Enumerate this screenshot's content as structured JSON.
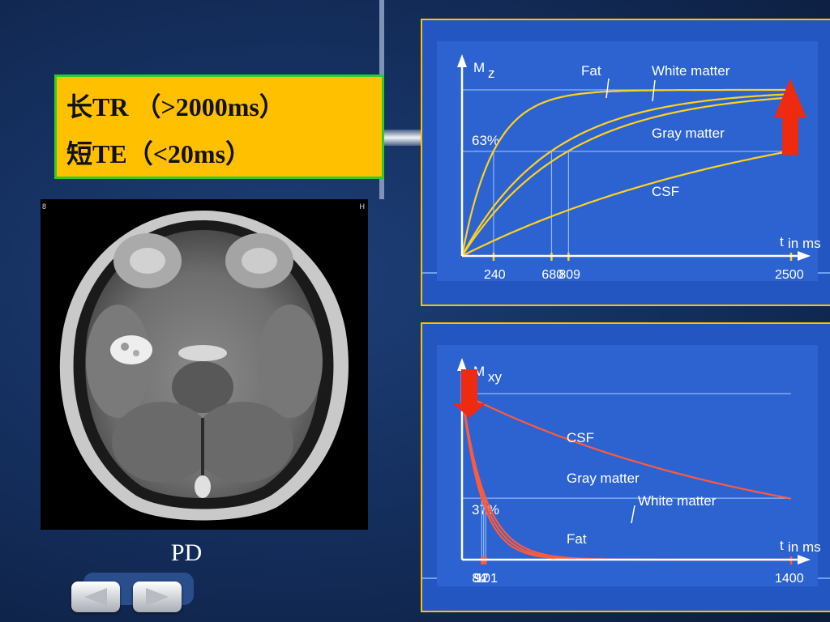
{
  "slide": {
    "conditions": [
      {
        "text": "长TR （>2000ms）"
      },
      {
        "text": "短TE（<20ms）"
      }
    ],
    "image_label": "PD",
    "image_corner_left": "8",
    "image_corner_right": "H"
  },
  "colors": {
    "background": "#15305f",
    "textbox": "#ffc000",
    "textbox_border": "#2ecc2e",
    "panel": "#2456c2",
    "panel_border": "#ffc000",
    "t1_curves": "#ffd21f",
    "t2_curves": "#ff5a3c",
    "arrow": "#ee2a10"
  },
  "chart_data": [
    {
      "type": "line",
      "y_axis_label": {
        "main": "M",
        "sub": "z"
      },
      "x_axis_label": {
        "main": "t",
        "sub": "in ms"
      },
      "x_range": [
        0,
        2500
      ],
      "y_range": [
        0,
        1.0
      ],
      "threshold": {
        "label": "63%",
        "value": 0.63
      },
      "tick_labels": [
        "240",
        "680",
        "809",
        "2500"
      ],
      "ticks": [
        240,
        680,
        809,
        2500
      ],
      "series": [
        {
          "name": "Fat",
          "time_constant": 240
        },
        {
          "name": "White matter",
          "time_constant": 680
        },
        {
          "name": "Gray matter",
          "time_constant": 809
        },
        {
          "name": "CSF",
          "time_constant": 2500
        }
      ],
      "arrow": {
        "direction": "up",
        "at_x": 2500
      }
    },
    {
      "type": "line",
      "y_axis_label": {
        "main": "M",
        "sub": "xy"
      },
      "x_axis_label": {
        "main": "t",
        "sub": "in ms"
      },
      "x_range": [
        0,
        1400
      ],
      "y_range": [
        0,
        1.0
      ],
      "threshold": {
        "label": "37%",
        "value": 0.37
      },
      "tick_labels": [
        "84",
        "92",
        "101",
        "1400"
      ],
      "ticks": [
        84,
        92,
        101,
        1400
      ],
      "series": [
        {
          "name": "CSF",
          "time_constant": 1400
        },
        {
          "name": "Gray matter",
          "time_constant": 101
        },
        {
          "name": "White matter",
          "time_constant": 92
        },
        {
          "name": "Fat",
          "time_constant": 84
        }
      ],
      "arrow": {
        "direction": "down",
        "at_x": 0
      }
    }
  ]
}
